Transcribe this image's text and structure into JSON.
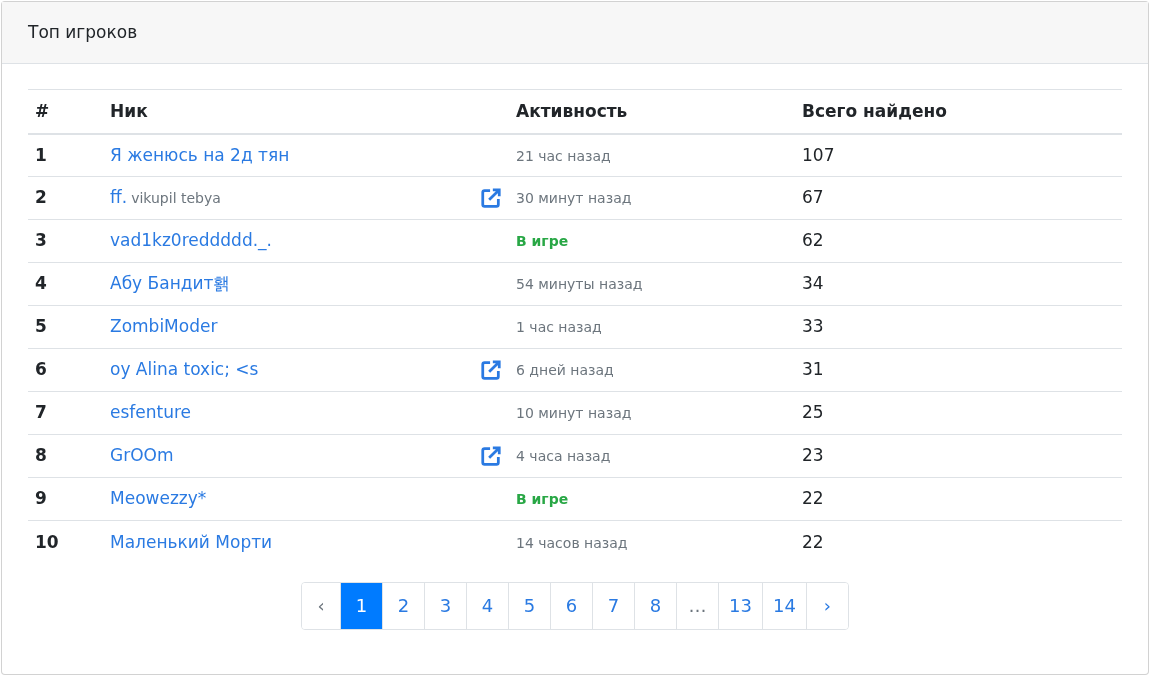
{
  "card": {
    "title": "Топ игроков"
  },
  "table": {
    "columns": [
      "#",
      "Ник",
      "Активность",
      "Всего найдено"
    ],
    "rows": [
      {
        "rank": "1",
        "nick": "Я женюсь на 2д тян",
        "link_icon": false,
        "activity": {
          "kind": "ago",
          "text": "21 час назад"
        },
        "total": "107"
      },
      {
        "rank": "2",
        "nick": "ff.",
        "nick_note": "vikupil tebya",
        "link_icon": true,
        "activity": {
          "kind": "ago",
          "text": "30 минут назад"
        },
        "total": "67"
      },
      {
        "rank": "3",
        "nick": "vad1kz0reddddd._.",
        "link_icon": false,
        "activity": {
          "kind": "online",
          "text": "В игре"
        },
        "total": "62"
      },
      {
        "rank": "4",
        "nick": "Абу Бандит홹",
        "link_icon": false,
        "activity": {
          "kind": "ago",
          "text": "54 минуты назад"
        },
        "total": "34"
      },
      {
        "rank": "5",
        "nick": "ZombiModer",
        "link_icon": false,
        "activity": {
          "kind": "ago",
          "text": "1 час назад"
        },
        "total": "33"
      },
      {
        "rank": "6",
        "nick": "oy Alina toxic; <s",
        "link_icon": true,
        "activity": {
          "kind": "ago",
          "text": "6 дней назад"
        },
        "total": "31"
      },
      {
        "rank": "7",
        "nick": "esfenture",
        "link_icon": false,
        "activity": {
          "kind": "ago",
          "text": "10 минут назад"
        },
        "total": "25"
      },
      {
        "rank": "8",
        "nick": "GrOOm",
        "link_icon": true,
        "activity": {
          "kind": "ago",
          "text": "4 часа назад"
        },
        "total": "23"
      },
      {
        "rank": "9",
        "nick": "Meowezzy*",
        "link_icon": false,
        "activity": {
          "kind": "online",
          "text": "В игре"
        },
        "total": "22"
      },
      {
        "rank": "10",
        "nick": "Маленький Морти",
        "link_icon": false,
        "activity": {
          "kind": "ago",
          "text": "14 часов назад"
        },
        "total": "22"
      }
    ]
  },
  "pagination": [
    {
      "kind": "prev",
      "label": "‹",
      "selected": false
    },
    {
      "kind": "page",
      "label": "1",
      "selected": true
    },
    {
      "kind": "page",
      "label": "2",
      "selected": false
    },
    {
      "kind": "page",
      "label": "3",
      "selected": false
    },
    {
      "kind": "page",
      "label": "4",
      "selected": false
    },
    {
      "kind": "page",
      "label": "5",
      "selected": false
    },
    {
      "kind": "page",
      "label": "6",
      "selected": false
    },
    {
      "kind": "page",
      "label": "7",
      "selected": false
    },
    {
      "kind": "page",
      "label": "8",
      "selected": false
    },
    {
      "kind": "ellipsis",
      "label": "…",
      "selected": false
    },
    {
      "kind": "page",
      "label": "13",
      "selected": false
    },
    {
      "kind": "page",
      "label": "14",
      "selected": false
    },
    {
      "kind": "next",
      "label": "›",
      "selected": false
    }
  ]
}
